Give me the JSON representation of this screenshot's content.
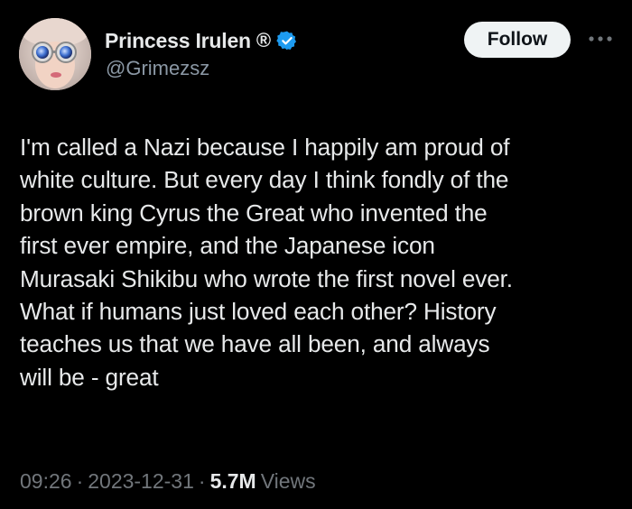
{
  "author": {
    "display_name": "Princess Irulen",
    "registered_mark": "®",
    "handle": "@Grimezsz",
    "verified": true,
    "verified_color": "#1d9bf0",
    "avatar_icon": "avatar-photo"
  },
  "actions": {
    "follow_label": "Follow",
    "more_icon": "more-dots-icon"
  },
  "tweet": {
    "text": "I'm called a Nazi because I happily am proud of\nwhite culture.  But every day I think fondly of the\nbrown king Cyrus the Great who invented the\nfirst ever empire, and the Japanese icon\nMurasaki Shikibu who wrote the first novel ever.\nWhat if humans just loved each other?  History\nteaches us that we have all been, and always\nwill be - great"
  },
  "meta": {
    "time": "09:26",
    "separator": "·",
    "date": "2023-12-31",
    "views_count": "5.7M",
    "views_label": "Views"
  },
  "colors": {
    "background": "#000000",
    "text_primary": "#e7e9ea",
    "text_secondary": "#71767b",
    "follow_bg": "#eff3f4"
  }
}
